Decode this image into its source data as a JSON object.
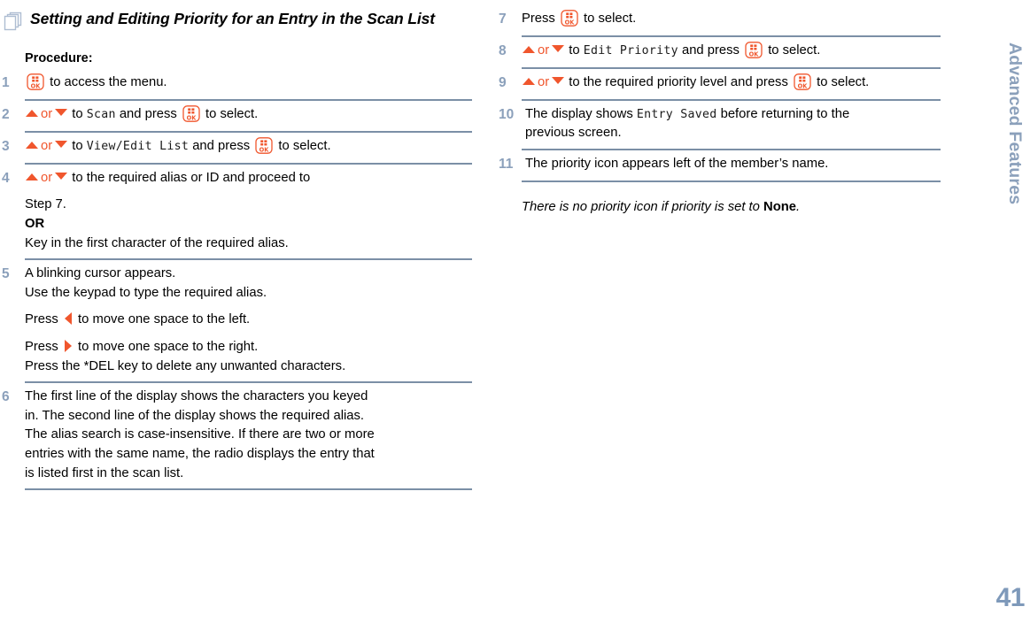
{
  "document": {
    "heading": "Setting and Editing Priority for an Entry in the Scan List",
    "heading_icon": "pages-icon",
    "section_label": "Procedure:"
  },
  "colors": {
    "accent_orange": "#f0562d",
    "step_number_blue": "#8ba0bb",
    "divider": "#7b8fa6",
    "sidebar_text": "#8ba0bb"
  },
  "steps": [
    {
      "number": "1",
      "lines": [
        {
          "parts": [
            {
              "type": "icon",
              "name": "ok-key-icon"
            },
            {
              "type": "text",
              "value": " to access the menu."
            }
          ]
        }
      ]
    },
    {
      "number": "2",
      "lines": [
        {
          "parts": [
            {
              "type": "icon",
              "name": "arrow-up-icon"
            },
            {
              "type": "orange",
              "value": "or"
            },
            {
              "type": "icon",
              "name": "arrow-down-icon"
            },
            {
              "type": "text",
              "value": " to "
            },
            {
              "type": "lcd",
              "value": "Scan"
            },
            {
              "type": "text",
              "value": " and press "
            },
            {
              "type": "icon",
              "name": "ok-key-icon"
            },
            {
              "type": "text",
              "value": " to select."
            }
          ]
        }
      ]
    },
    {
      "number": "3",
      "lines": [
        {
          "parts": [
            {
              "type": "icon",
              "name": "arrow-up-icon"
            },
            {
              "type": "orange",
              "value": "or"
            },
            {
              "type": "icon",
              "name": "arrow-down-icon"
            },
            {
              "type": "text",
              "value": " to "
            },
            {
              "type": "lcd",
              "value": "View/Edit List"
            },
            {
              "type": "text",
              "value": " and press "
            },
            {
              "type": "icon",
              "name": "ok-key-icon"
            },
            {
              "type": "text",
              "value": " to select."
            }
          ]
        }
      ]
    },
    {
      "number": "4",
      "lines": [
        {
          "parts": [
            {
              "type": "icon",
              "name": "arrow-up-icon"
            },
            {
              "type": "orange",
              "value": "or"
            },
            {
              "type": "icon",
              "name": "arrow-down-icon"
            },
            {
              "type": "text",
              "value": " to the required alias or ID and proceed to"
            }
          ]
        },
        {
          "gap": true,
          "parts": [
            {
              "type": "text",
              "value": "Step 7."
            }
          ]
        },
        {
          "parts": [
            {
              "type": "bold",
              "value": "OR"
            }
          ]
        },
        {
          "parts": [
            {
              "type": "text",
              "value": "Key in the first character of the required alias."
            }
          ]
        }
      ]
    },
    {
      "number": "5",
      "lines": [
        {
          "parts": [
            {
              "type": "text",
              "value": "A blinking cursor appears."
            }
          ]
        },
        {
          "parts": [
            {
              "type": "text",
              "value": "Use the keypad to type the required alias."
            }
          ]
        },
        {
          "gap": true,
          "parts": [
            {
              "type": "text",
              "value": "Press "
            },
            {
              "type": "icon",
              "name": "arrow-left-icon"
            },
            {
              "type": "text",
              "value": " to move one space to the left."
            }
          ]
        },
        {
          "gap": true,
          "parts": [
            {
              "type": "text",
              "value": "Press "
            },
            {
              "type": "icon",
              "name": "arrow-right-icon"
            },
            {
              "type": "text",
              "value": " to move one space to the right."
            }
          ]
        },
        {
          "parts": [
            {
              "type": "text",
              "value": "Press the *DEL key to delete any unwanted characters."
            }
          ]
        }
      ]
    },
    {
      "number": "6",
      "lines": [
        {
          "parts": [
            {
              "type": "text",
              "value": "The first line of the display shows the characters you keyed"
            }
          ]
        },
        {
          "parts": [
            {
              "type": "text",
              "value": "in. The second line of the display shows the required alias."
            }
          ]
        },
        {
          "parts": [
            {
              "type": "text",
              "value": "The alias search is case-insensitive. If there are two or more"
            }
          ]
        },
        {
          "parts": [
            {
              "type": "text",
              "value": "entries with the same name, the radio displays the entry that"
            }
          ]
        },
        {
          "parts": [
            {
              "type": "text",
              "value": "is listed first in the scan list."
            }
          ]
        }
      ]
    },
    {
      "number": "7",
      "column": "right",
      "lines": [
        {
          "parts": [
            {
              "type": "text",
              "value": "Press "
            },
            {
              "type": "icon",
              "name": "ok-key-icon"
            },
            {
              "type": "text",
              "value": " to select."
            }
          ]
        }
      ]
    },
    {
      "number": "8",
      "column": "right",
      "lines": [
        {
          "parts": [
            {
              "type": "icon",
              "name": "arrow-up-icon"
            },
            {
              "type": "orange",
              "value": "or"
            },
            {
              "type": "icon",
              "name": "arrow-down-icon"
            },
            {
              "type": "text",
              "value": " to "
            },
            {
              "type": "lcd",
              "value": "Edit Priority"
            },
            {
              "type": "text",
              "value": " and press "
            },
            {
              "type": "icon",
              "name": "ok-key-icon"
            },
            {
              "type": "text",
              "value": " to select."
            }
          ]
        }
      ]
    },
    {
      "number": "9",
      "column": "right",
      "lines": [
        {
          "parts": [
            {
              "type": "icon",
              "name": "arrow-up-icon"
            },
            {
              "type": "orange",
              "value": "or"
            },
            {
              "type": "icon",
              "name": "arrow-down-icon"
            },
            {
              "type": "text",
              "value": " to the required priority level and press "
            },
            {
              "type": "icon",
              "name": "ok-key-icon"
            },
            {
              "type": "text",
              "value": " to select."
            }
          ]
        }
      ]
    },
    {
      "number": "10",
      "column": "right",
      "lines": [
        {
          "parts": [
            {
              "type": "text",
              "value": "The display shows "
            },
            {
              "type": "lcd",
              "value": "Entry Saved"
            },
            {
              "type": "text",
              "value": " before returning to the"
            }
          ]
        },
        {
          "parts": [
            {
              "type": "text",
              "value": "previous screen."
            }
          ]
        }
      ]
    },
    {
      "number": "11",
      "column": "right",
      "lines": [
        {
          "parts": [
            {
              "type": "text",
              "value": "The priority icon appears left of the member’s name."
            }
          ]
        }
      ]
    }
  ],
  "note": {
    "prefix": "There is no priority icon if priority is set to ",
    "bold": "None",
    "suffix": "."
  },
  "sidebar": {
    "tab_label": "Advanced Features",
    "page_number": "41"
  }
}
